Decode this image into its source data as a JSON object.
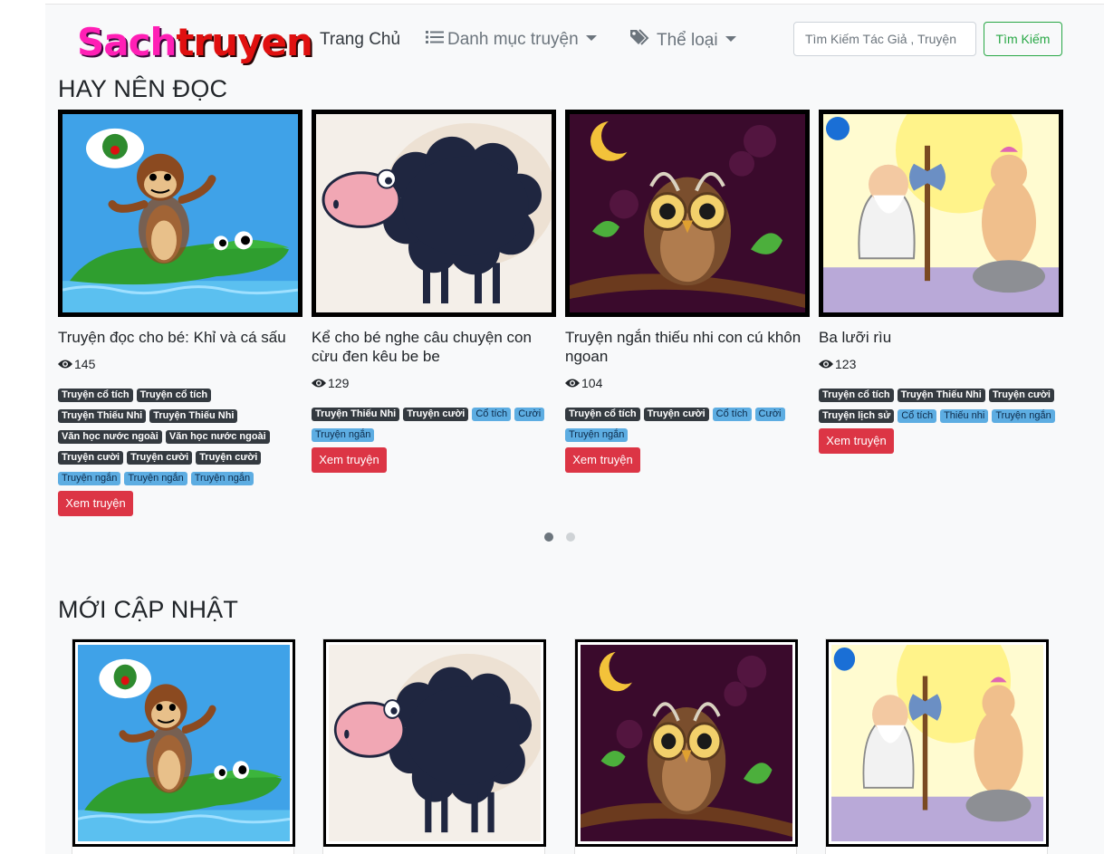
{
  "navbar": {
    "brand_part1": "Sach",
    "brand_part2": "truyen",
    "home": "Trang Chủ",
    "categories": "Danh mục truyện",
    "genres": "Thể loại",
    "search_placeholder": "Tìm Kiếm Tác Giả , Truyện",
    "search_button": "Tìm Kiếm"
  },
  "sections": {
    "recommended_title": "HAY NÊN ĐỌC",
    "updated_title": "MỚI CẬP NHẬT"
  },
  "read_label": "Xem truyện",
  "cards": [
    {
      "title": "Truyện đọc cho bé: Khỉ và cá sấu",
      "views": "145",
      "image": "monkey-crocodile",
      "tags": [
        {
          "label": "Truyện cổ tích",
          "style": "dark"
        },
        {
          "label": "Truyện cổ tích",
          "style": "dark"
        },
        {
          "label": "Truyện Thiếu Nhi",
          "style": "dark"
        },
        {
          "label": "Truyện Thiếu Nhi",
          "style": "dark"
        },
        {
          "label": "Văn học nước ngoài",
          "style": "dark"
        },
        {
          "label": "Văn học nước ngoài",
          "style": "dark"
        },
        {
          "label": "Truyện cười",
          "style": "dark"
        },
        {
          "label": "Truyện cười",
          "style": "dark"
        },
        {
          "label": "Truyện cười",
          "style": "dark"
        },
        {
          "label": "Truyện ngắn",
          "style": "info"
        },
        {
          "label": "Truyện ngắn",
          "style": "info"
        },
        {
          "label": "Truyện ngắn",
          "style": "info"
        }
      ]
    },
    {
      "title": "Kể cho bé nghe câu chuyện con cừu đen kêu be be",
      "views": "129",
      "image": "black-sheep",
      "tags": [
        {
          "label": "Truyện Thiếu Nhi",
          "style": "dark"
        },
        {
          "label": "Truyện cười",
          "style": "dark"
        },
        {
          "label": "Cổ tích",
          "style": "info"
        },
        {
          "label": "Cười",
          "style": "info"
        },
        {
          "label": "Truyện ngắn",
          "style": "info"
        }
      ]
    },
    {
      "title": "Truyện ngắn thiếu nhi con cú khôn ngoan",
      "views": "104",
      "image": "owl",
      "tags": [
        {
          "label": "Truyện cổ tích",
          "style": "dark"
        },
        {
          "label": "Truyện cười",
          "style": "dark"
        },
        {
          "label": "Cổ tích",
          "style": "info"
        },
        {
          "label": "Cười",
          "style": "info"
        },
        {
          "label": "Truyện ngắn",
          "style": "info"
        }
      ]
    },
    {
      "title": "Ba lưỡi rìu",
      "views": "123",
      "image": "three-axes",
      "tags": [
        {
          "label": "Truyện cổ tích",
          "style": "dark"
        },
        {
          "label": "Truyện Thiếu Nhi",
          "style": "dark"
        },
        {
          "label": "Truyện cười",
          "style": "dark"
        },
        {
          "label": "Truyện lịch sử",
          "style": "dark"
        },
        {
          "label": "Cổ tích",
          "style": "info"
        },
        {
          "label": "Thiếu nhi",
          "style": "info"
        },
        {
          "label": "Truyện ngắn",
          "style": "info"
        }
      ]
    }
  ],
  "carousel": {
    "slides": 2,
    "active": 0
  },
  "colors": {
    "brand_pink": "#ff1fb5",
    "brand_red": "#e01010",
    "success": "#28a745",
    "danger": "#dc3545",
    "badge_dark": "#343a40",
    "badge_info": "#5dade2"
  }
}
